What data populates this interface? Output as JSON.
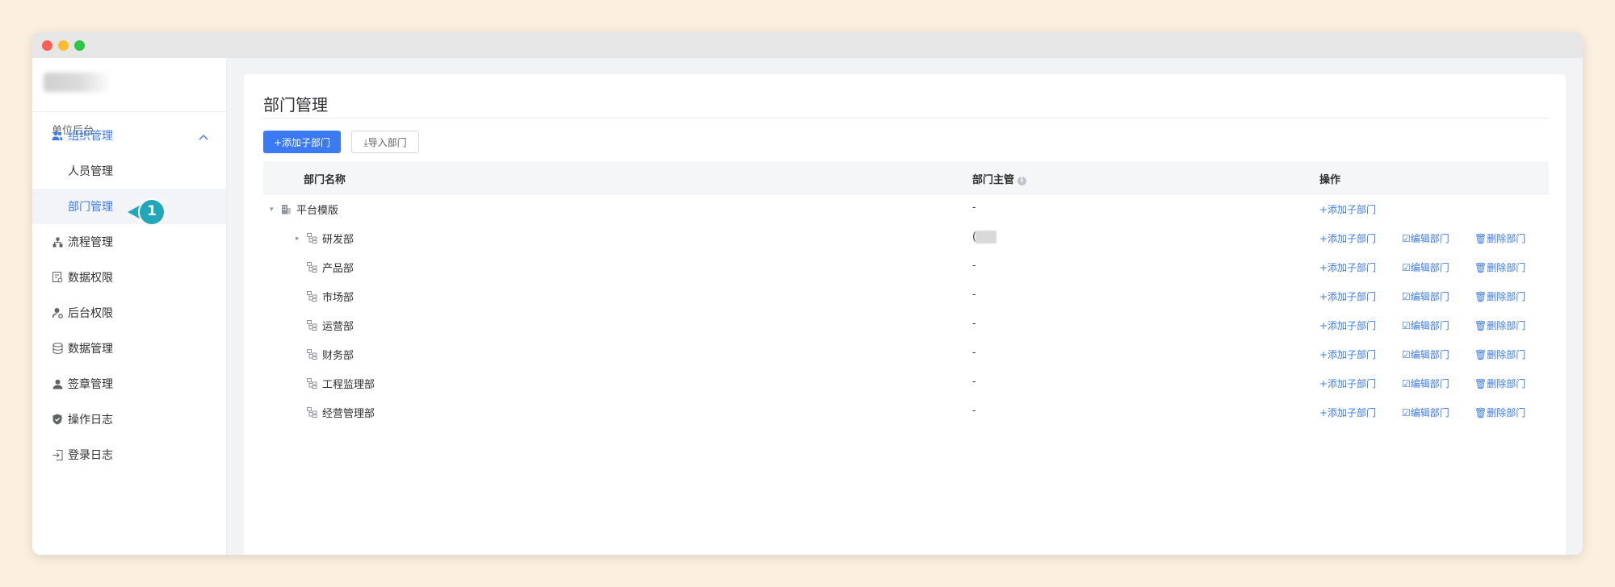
{
  "sidebar": {
    "section_label": "单位后台",
    "group": {
      "label": "组织管理",
      "icon": "users-icon"
    },
    "sub_items": [
      {
        "label": "人员管理",
        "active": false
      },
      {
        "label": "部门管理",
        "active": true
      }
    ],
    "items": [
      {
        "label": "流程管理",
        "icon": "flow-icon"
      },
      {
        "label": "数据权限",
        "icon": "data-permission-icon"
      },
      {
        "label": "后台权限",
        "icon": "admin-permission-icon"
      },
      {
        "label": "数据管理",
        "icon": "database-icon"
      },
      {
        "label": "签章管理",
        "icon": "seal-icon"
      },
      {
        "label": "操作日志",
        "icon": "shield-icon"
      },
      {
        "label": "登录日志",
        "icon": "login-icon"
      }
    ],
    "step_badge": "1"
  },
  "page": {
    "title": "部门管理",
    "add_button": "+添加子部门",
    "import_button": "⤓导入部门"
  },
  "table": {
    "columns": {
      "name": "部门名称",
      "manager": "部门主管",
      "actions": "操作"
    },
    "action_labels": {
      "add": "+添加子部门",
      "edit": "编辑部门",
      "delete": "删除部门"
    },
    "rows": [
      {
        "name": "平台模版",
        "manager": "-",
        "level": 0,
        "expanded": true
      },
      {
        "name": "研发部",
        "manager": "(",
        "level": 1,
        "collapsed": true
      },
      {
        "name": "产品部",
        "manager": "-",
        "level": 1
      },
      {
        "name": "市场部",
        "manager": "-",
        "level": 1
      },
      {
        "name": "运营部",
        "manager": "-",
        "level": 1
      },
      {
        "name": "财务部",
        "manager": "-",
        "level": 1
      },
      {
        "name": "工程监理部",
        "manager": "-",
        "level": 1
      },
      {
        "name": "经营管理部",
        "manager": "-",
        "level": 1
      }
    ]
  },
  "colors": {
    "accent": "#3a7af2",
    "badge": "#20a7b8",
    "background": "#fbf0e0"
  }
}
